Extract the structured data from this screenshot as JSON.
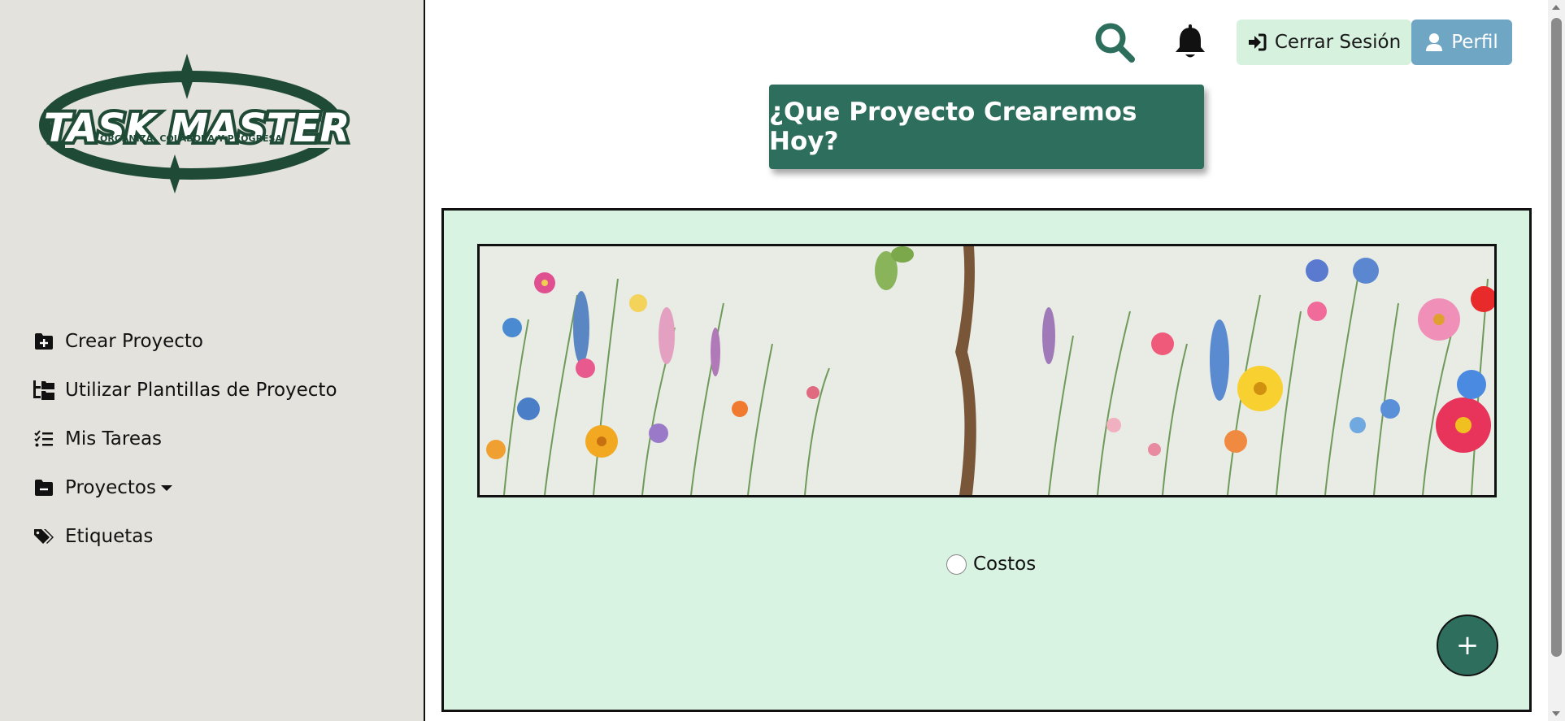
{
  "sidebar": {
    "logo": {
      "title": "TASK MASTER",
      "tagline": "ORGANIZA, COLABORA Y PROGRESA"
    },
    "items": [
      {
        "label": "Crear Proyecto",
        "icon": "folder-plus-icon"
      },
      {
        "label": "Utilizar Plantillas de Proyecto",
        "icon": "folder-tree-icon"
      },
      {
        "label": "Mis Tareas",
        "icon": "list-check-icon"
      },
      {
        "label": "Proyectos",
        "icon": "folder-minus-icon",
        "dropdown": true
      },
      {
        "label": "Etiquetas",
        "icon": "tags-icon"
      }
    ]
  },
  "header": {
    "logout_label": "Cerrar Sesión",
    "profile_label": "Perfil"
  },
  "hero": {
    "label": "¿Que Proyecto Crearemos Hoy?"
  },
  "projects": [
    {
      "label": "Costos",
      "selected": false
    }
  ],
  "fab": {
    "label": "+"
  },
  "colors": {
    "primary": "#2e6e5d",
    "sidebar_bg": "#e3e2dc",
    "panel_bg": "#d9f3e3",
    "logout_bg": "#d7f1df",
    "profile_bg": "#6fa6c4"
  }
}
